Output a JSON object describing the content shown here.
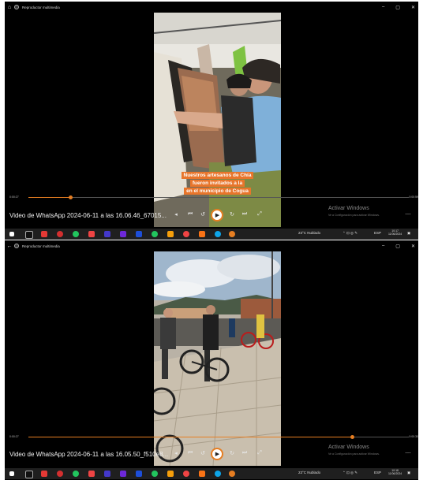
{
  "app_title": "Reproductor multimedia",
  "watermark": {
    "title": "Activar Windows",
    "subtitle": "Ve a Configuración para activar Windows."
  },
  "screens": [
    {
      "time_elapsed": "0:00:27",
      "time_total": "0:00:59",
      "progress": 0.11,
      "file_name": "Video de WhatsApp 2024-06-11 a las 16.06.46_67015...",
      "caption_lines": [
        "Nuestros artesanos de Chía",
        "fueron invitados a la",
        "",
        "en el municipio de Cogua"
      ]
    },
    {
      "time_elapsed": "0:00:27",
      "time_total": "0:00:30",
      "progress": 0.85,
      "file_name": "Video de WhatsApp 2024-06-11 a las 16.05.50_f510e8...",
      "caption_lines": []
    }
  ],
  "taskbar": {
    "weather": "23°C Nublado",
    "lang": "ESP",
    "clock_top": "10:17",
    "clock_date": "11/06/2024",
    "clock_top_2": "10:18",
    "clock_date_2": "11/06/2024",
    "icon_colors": [
      "#ffffff",
      "#e53935",
      "#3b82f6",
      "#22c55e",
      "#ef4444",
      "#6366f1",
      "#8b5cf6",
      "#22c55e",
      "#f59e0b",
      "#f97316",
      "#3b82f6",
      "#e67e22"
    ]
  }
}
